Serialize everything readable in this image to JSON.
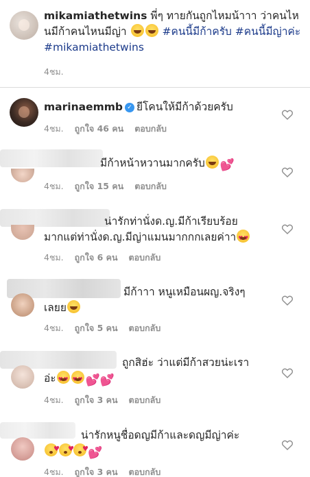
{
  "caption": {
    "username": "mikamiathetwins",
    "text": " พี่ๆ ทายกันถูกไหมน้าาา ว่าคนไหนมีก้าคนไหนมีญ่า ",
    "tags": "#คนนี้มีก้าครับ #คนนี้มีญ่าค่ะ #mikamiathetwins",
    "time": "4ชม."
  },
  "comments": [
    {
      "username": "marinaemmb",
      "text": "ยีโคนให้มีก้าด้วยครับ",
      "time": "4ชม.",
      "likes": "ถูกใจ 46 คน",
      "reply": "ตอบกลับ"
    },
    {
      "text": "มีก้าหน้าหวานมากครับ",
      "time": "4ชม.",
      "likes": "ถูกใจ 15 คน",
      "reply": "ตอบกลับ"
    },
    {
      "text_line1": "น่ารักท่านั่งด.ญ.มีก้าเรียบร้อย",
      "text_line2": "มากแต่ท่านั่งด.ญ.มีญ่าแมนมากกกเลยค่าา",
      "time": "4ชม.",
      "likes": "ถูกใจ 6 คน",
      "reply": "ตอบกลับ"
    },
    {
      "text_line1": "มีก้าาา หนูเหมือนผญ.จริงๆ",
      "text_line2": "เลยย",
      "time": "4ชม.",
      "likes": "ถูกใจ 5 คน",
      "reply": "ตอบกลับ"
    },
    {
      "text_line1": "ถูกสิฮ่ะ  ว่าแต่มีก้าสวยน่ะเรา",
      "text_line2": "อ่ะ",
      "time": "4ชม.",
      "likes": "ถูกใจ 3 คน",
      "reply": "ตอบกลับ"
    },
    {
      "text": "น่ารักหนูชื่อดญมีก้าและดญมีญ่าค่ะ",
      "time": "4ชม.",
      "likes": "ถูกใจ 3 คน",
      "reply": "ตอบกลับ"
    }
  ],
  "icons": {
    "like": "heart-outline-icon",
    "verified": "verified-badge-icon"
  },
  "colors": {
    "text": "#262626",
    "meta": "#8e8e8e",
    "hashtag": "#1b3a8a",
    "verified": "#3897f0"
  }
}
